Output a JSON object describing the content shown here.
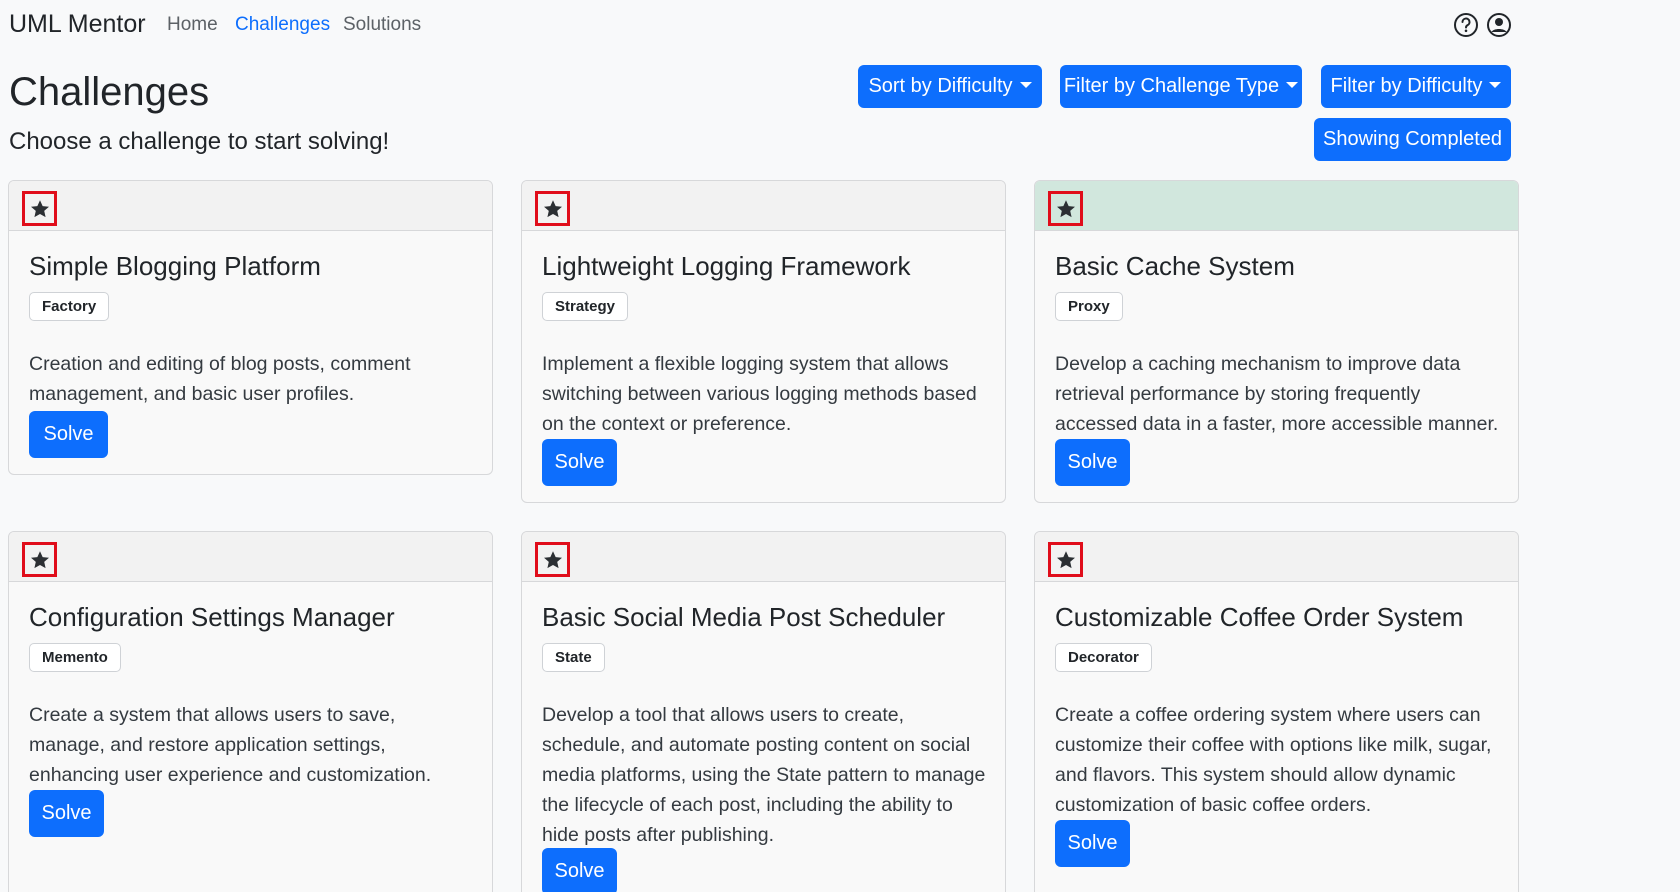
{
  "nav": {
    "brand": "UML Mentor",
    "links": [
      "Home",
      "Challenges",
      "Solutions"
    ],
    "active": "Challenges"
  },
  "icons": {
    "help": "question-circle-icon",
    "account": "user-circle-icon",
    "favorite": "star-icon"
  },
  "header": {
    "title": "Challenges",
    "subtitle": "Choose a challenge to start solving!"
  },
  "toolbar": {
    "sort_label": "Sort by Difficulty",
    "filter_type_label": "Filter by Challenge Type",
    "filter_difficulty_label": "Filter by Difficulty",
    "completed_toggle_label": "Showing Completed"
  },
  "colors": {
    "primary": "#0d6efd",
    "completed_header": "#d1e7dd",
    "highlight_border": "#e00d1a"
  },
  "challenges": [
    {
      "title": "Simple Blogging Platform",
      "pattern": "Factory",
      "description": "Creation and editing of blog posts, comment management, and basic user profiles.",
      "action": "Solve",
      "completed": false
    },
    {
      "title": "Lightweight Logging Framework",
      "pattern": "Strategy",
      "description": "Implement a flexible logging system that allows switching between various logging methods based on the context or preference.",
      "action": "Solve",
      "completed": false
    },
    {
      "title": "Basic Cache System",
      "pattern": "Proxy",
      "description": "Develop a caching mechanism to improve data retrieval performance by storing frequently accessed data in a faster, more accessible manner.",
      "action": "Solve",
      "completed": true
    },
    {
      "title": "Configuration Settings Manager",
      "pattern": "Memento",
      "description": "Create a system that allows users to save, manage, and restore application settings, enhancing user experience and customization.",
      "action": "Solve",
      "completed": false
    },
    {
      "title": "Basic Social Media Post Scheduler",
      "pattern": "State",
      "description": "Develop a tool that allows users to create, schedule, and automate posting content on social media platforms, using the State pattern to manage the lifecycle of each post, including the ability to hide posts after publishing.",
      "action": "Solve",
      "completed": false
    },
    {
      "title": "Customizable Coffee Order System",
      "pattern": "Decorator",
      "description": "Create a coffee ordering system where users can customize their coffee with options like milk, sugar, and flavors. This system should allow dynamic customization of basic coffee orders.",
      "action": "Solve",
      "completed": false
    }
  ]
}
